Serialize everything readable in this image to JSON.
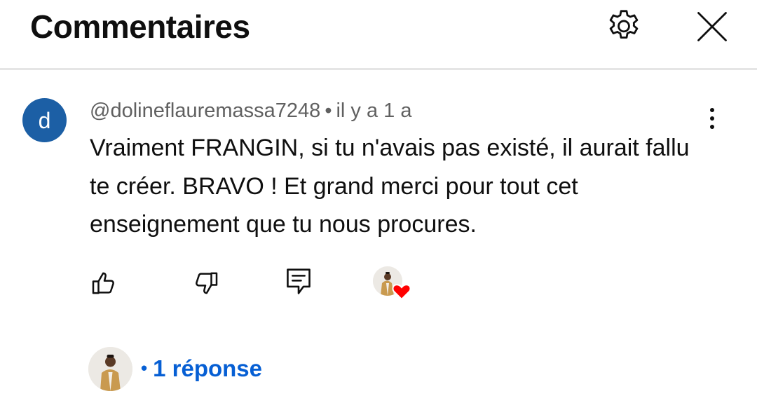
{
  "header": {
    "title": "Commentaires",
    "settings_icon": "gear-icon",
    "close_icon": "close-icon"
  },
  "comment": {
    "avatar_letter": "d",
    "avatar_color": "#1c5fa5",
    "author": "@dolineflauremassa7248",
    "separator": "•",
    "time": "il y a 1 a",
    "text": "Vraiment FRANGIN, si tu n'avais pas existé, il aurait fallu te créer. BRAVO ! Et grand merci pour tout cet enseignement que tu nous procures.",
    "more_icon": "vertical-dots-icon"
  },
  "actions": {
    "like_icon": "thumbs-up-icon",
    "dislike_icon": "thumbs-down-icon",
    "reply_icon": "comment-reply-icon",
    "creator_heart_icon": "heart-icon",
    "heart_color": "#ff0000"
  },
  "replies": {
    "bullet": "•",
    "label": "1 réponse",
    "link_color": "#065fd4"
  }
}
